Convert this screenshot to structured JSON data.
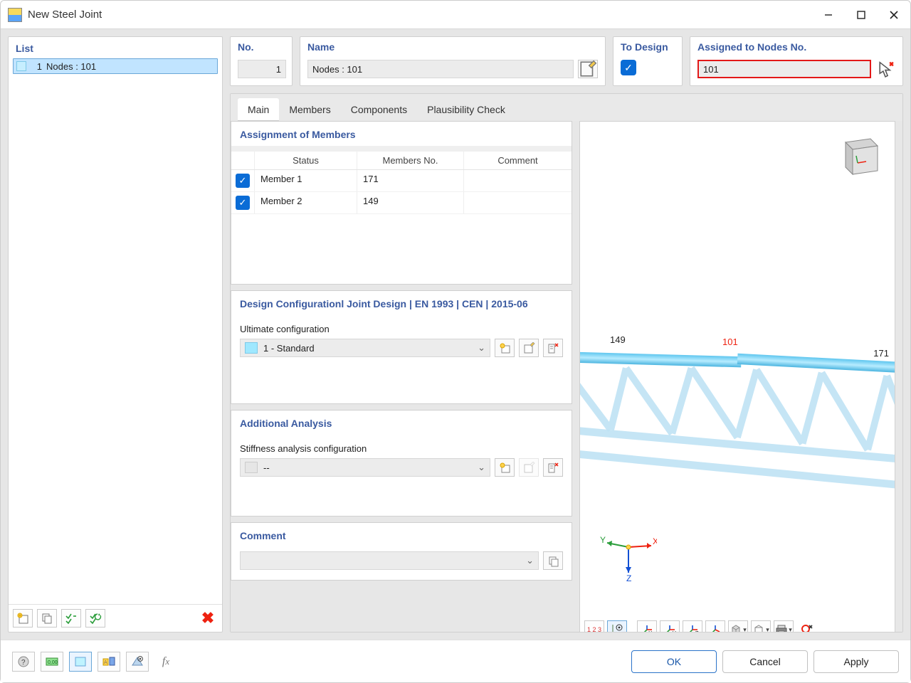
{
  "window": {
    "title": "New Steel Joint"
  },
  "list": {
    "heading": "List",
    "items": [
      {
        "index": "1",
        "label": "Nodes : 101"
      }
    ]
  },
  "fields": {
    "no_label": "No.",
    "no_value": "1",
    "name_label": "Name",
    "name_value": "Nodes : 101",
    "to_design_label": "To Design",
    "to_design_checked": true,
    "assigned_label": "Assigned to Nodes No.",
    "assigned_value": "101"
  },
  "tabs": {
    "items": [
      "Main",
      "Members",
      "Components",
      "Plausibility Check"
    ],
    "active": 0
  },
  "assignment": {
    "heading": "Assignment of Members",
    "headers": {
      "status": "Status",
      "members_no": "Members No.",
      "comment": "Comment"
    },
    "rows": [
      {
        "checked": true,
        "status": "Member 1",
        "members_no": "171",
        "comment": ""
      },
      {
        "checked": true,
        "status": "Member 2",
        "members_no": "149",
        "comment": ""
      }
    ]
  },
  "design_cfg": {
    "heading": "Design Configurationl Joint Design | EN 1993 | CEN | 2015-06",
    "ultimate_label": "Ultimate configuration",
    "ultimate_value": "1 - Standard"
  },
  "additional": {
    "heading": "Additional Analysis",
    "stiffness_label": "Stiffness analysis configuration",
    "stiffness_value": "--"
  },
  "comment": {
    "heading": "Comment",
    "value": ""
  },
  "preview": {
    "nodes": {
      "left": "149",
      "center": "101",
      "right": "171"
    },
    "axes": {
      "x": "X",
      "y": "Y",
      "z": "Z"
    }
  },
  "footer": {
    "ok": "OK",
    "cancel": "Cancel",
    "apply": "Apply"
  }
}
